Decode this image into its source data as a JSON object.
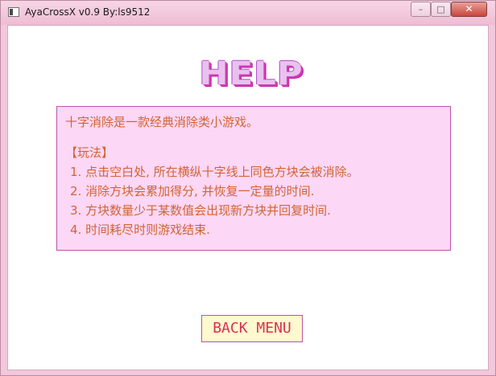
{
  "window": {
    "title": "AyaCrossX v0.9 By:ls9512",
    "controls": {
      "minimize": "–",
      "maximize": "□",
      "close": "✕"
    }
  },
  "help": {
    "title": "HELP",
    "intro": "十字消除是一款经典消除类小游戏。",
    "section_label": "【玩法】",
    "rules": [
      "1. 点击空白处, 所在横纵十字线上同色方块会被消除。",
      "2. 消除方块会累加得分, 并恢复一定量的时间.",
      "3. 方块数量少于某数值会出现新方块并回复时间.",
      "4. 时间耗尽时则游戏结束."
    ]
  },
  "back_button": {
    "label": "BACK MENU"
  }
}
